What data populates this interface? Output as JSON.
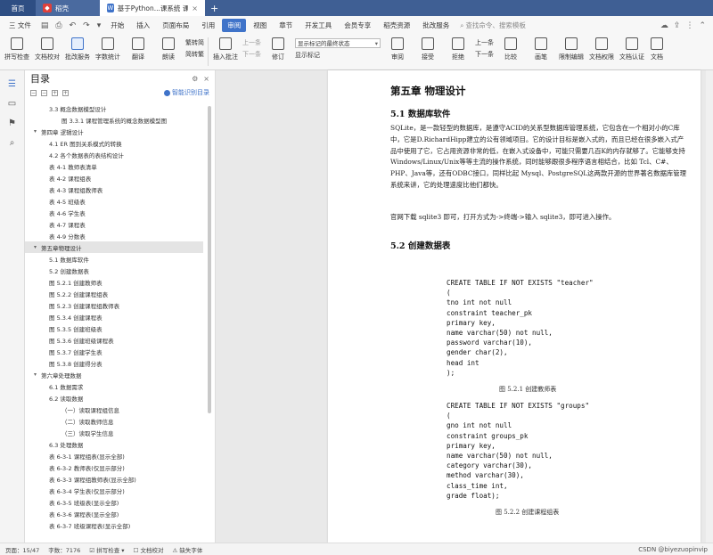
{
  "tabs": [
    {
      "label": "首页"
    },
    {
      "label": "稻壳"
    },
    {
      "label": "基于Python...课系统 课程论文"
    }
  ],
  "menu": {
    "file": "三 文件",
    "items": [
      "开始",
      "插入",
      "页面布局",
      "引用",
      "审阅",
      "视图",
      "章节",
      "开发工具",
      "会员专享",
      "稻壳资源",
      "批改服务"
    ],
    "active_index": 4,
    "search": "查找命令、搜索模板"
  },
  "ribbon": {
    "buttons": [
      "拼写检查",
      "文档校对",
      "批改服务",
      "字数统计",
      "翻译",
      "朗读"
    ],
    "selected_index": 2,
    "convert": [
      "繁转简",
      "简转繁"
    ],
    "comment": "插入批注",
    "nav_prev": "上一条",
    "nav_next": "下一条",
    "revise": "修订",
    "markup_dropdown": "显示标记的最终状态",
    "show_markup": "显示标记",
    "review": "审阅",
    "accept": "接受",
    "reject": "拒绝",
    "prev": "上一条",
    "next": "下一条",
    "compare": "比较",
    "pen": "画笔",
    "restrict": "限制编辑",
    "permission": "文档权限",
    "certify": "文档认证",
    "mark": "文档"
  },
  "toc": {
    "title": "目录",
    "smart": "智能识别目录",
    "items": [
      {
        "level": 2,
        "text": "3.3 概念数据模型设计"
      },
      {
        "level": 3,
        "text": "图 3.3.1 课程管理系统的概念数据模型图"
      },
      {
        "level": 1,
        "text": "第四章 逻辑设计"
      },
      {
        "level": 2,
        "text": "4.1 ER 图到关系模式的转换"
      },
      {
        "level": 2,
        "text": "4.2 各个数据表的表结构设计"
      },
      {
        "level": 2,
        "text": "表 4-1 教师表清单"
      },
      {
        "level": 2,
        "text": "表 4-2 课程组表"
      },
      {
        "level": 2,
        "text": "表 4-3 课程组教师表"
      },
      {
        "level": 2,
        "text": "表 4-5 班级表"
      },
      {
        "level": 2,
        "text": "表 4-6 学生表"
      },
      {
        "level": 2,
        "text": "表 4-7 课程表"
      },
      {
        "level": 2,
        "text": "表 4-9 分数表"
      },
      {
        "level": 1,
        "text": "第五章物理设计",
        "selected": true
      },
      {
        "level": 2,
        "text": "5.1 数据库软件"
      },
      {
        "level": 2,
        "text": "5.2 创建数据表"
      },
      {
        "level": 2,
        "text": "图 5.2.1 创建教师表"
      },
      {
        "level": 2,
        "text": "图 5.2.2 创建课程组表"
      },
      {
        "level": 2,
        "text": "图 5.2.3 创建课程组教师表"
      },
      {
        "level": 2,
        "text": "图 5.3.4 创建课程表"
      },
      {
        "level": 2,
        "text": "图 5.3.5 创建班级表"
      },
      {
        "level": 2,
        "text": "图 5.3.6 创建班级课程表"
      },
      {
        "level": 2,
        "text": "图 5.3.7 创建学生表"
      },
      {
        "level": 2,
        "text": "图 5.3.8 创建得分表"
      },
      {
        "level": 1,
        "text": "第六章处理数据"
      },
      {
        "level": 2,
        "text": "6.1 数据需求"
      },
      {
        "level": 2,
        "text": "6.2 读取数据"
      },
      {
        "level": 3,
        "text": "（一）读取课程组信息"
      },
      {
        "level": 3,
        "text": "（二）读取教师信息"
      },
      {
        "level": 3,
        "text": "（三）读取学生信息"
      },
      {
        "level": 2,
        "text": "6.3 处理数据"
      },
      {
        "level": 2,
        "text": "表 6-3-1 课程组表(显示全部)"
      },
      {
        "level": 2,
        "text": "表 6-3-2 教师表(仅显示部分)"
      },
      {
        "level": 2,
        "text": "表 6-3-3 课程组教师表(显示全部)"
      },
      {
        "level": 2,
        "text": "表 6-3-4 学生表(仅显示部分)"
      },
      {
        "level": 2,
        "text": "表 6-3-5 班级表(显示全部)"
      },
      {
        "level": 2,
        "text": "表 6-3-6 课程表(显示全部)"
      },
      {
        "level": 2,
        "text": "表 6-3-7 班级课程表(显示全部)"
      }
    ]
  },
  "doc": {
    "chapter": "第五章 物理设计",
    "s51": "5.1 数据库软件",
    "p1": "SQLite，是一款轻型的数据库，是遵守ACID的关系型数据库管理系统，它包含在一个相对小的C库中，它是D.RichardHipp建立的公有领域项目。它的设计目标是嵌入式的，而且已经在很多嵌入式产品中使用了它，它占用资源非常的低，在嵌入式设备中，可能只需要几百K的内存就够了。它能够支持Windows/Linux/Unix等等主流的操作系统，同时能够跟很多程序语言相结合，比如 Tcl、C#、PHP、Java等，还有ODBC接口，同样比起 Mysql、PostgreSQL这两款开源的世界著名数据库管理系统来讲，它的处理速度比他们都快。",
    "p2": "官网下载 sqlite3 即可，打开方式为->终端->输入 sqlite3，即可进入操作。",
    "s52": "5.2 创建数据表",
    "code1": "CREATE TABLE IF NOT EXISTS \"teacher\"\n(\ntno int not null\nconstraint teacher_pk\nprimary key,\nname varchar(50) not null,\npassword varchar(10),\ngender char(2),\nhead int\n);",
    "cap1": "图 5.2.1 创建教师表",
    "code2": "CREATE TABLE IF NOT EXISTS \"groups\"\n(\ngno int not null\nconstraint groups_pk\nprimary key,\nname varchar(50) not null,\ncategory varchar(30),\nmethod varchar(30),\nclass_time int,\ngrade float);",
    "cap2": "图 5.2.2 创建课程组表"
  },
  "status": {
    "page": "页面：15/47",
    "words": "字数：7176",
    "spell": "拼写检查",
    "proof": "文档校对",
    "missing_font": "缺失字体",
    "watermark": "CSDN @biyezuopinvip"
  }
}
